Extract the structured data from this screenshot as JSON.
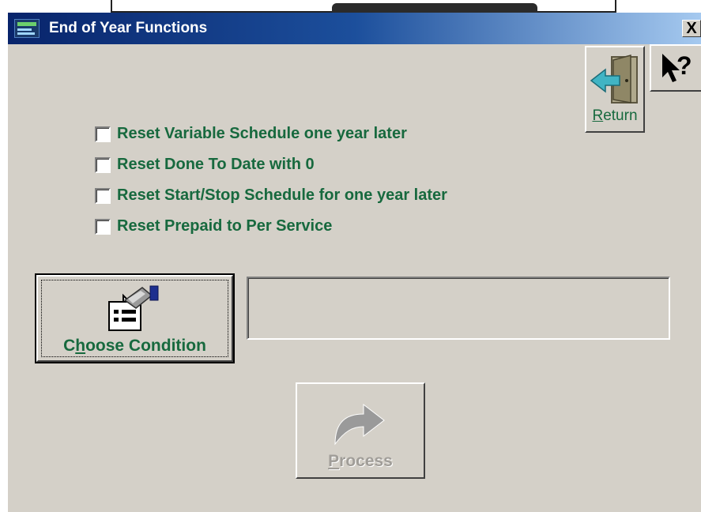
{
  "window": {
    "title": "End of Year Functions",
    "close_glyph": "X",
    "title_icon": "app-logo-icon"
  },
  "toolbar": {
    "help_icon": "help-pointer-icon",
    "return_label_first": "R",
    "return_label_rest": "eturn",
    "return_icon": "door-exit-icon"
  },
  "options": {
    "items": [
      {
        "label": "Reset Variable Schedule one year later",
        "checked": false
      },
      {
        "label": "Reset Done To Date with 0",
        "checked": false
      },
      {
        "label": "Reset Start/Stop Schedule for one year later",
        "checked": false
      },
      {
        "label": "Reset Prepaid to Per Service",
        "checked": false
      }
    ]
  },
  "condition": {
    "button_label_first": "C",
    "button_label_accel": "h",
    "button_label_rest": "oose Condition",
    "button_icon": "form-edit-icon",
    "field_value": ""
  },
  "process": {
    "label_first": "P",
    "label_rest": "rocess",
    "icon": "curved-arrow-icon",
    "enabled": false
  },
  "colors": {
    "label_green": "#17693e",
    "dialog_gray": "#d4d0c8",
    "title_blue": "#08246b",
    "disabled_text": "#a09d98"
  }
}
